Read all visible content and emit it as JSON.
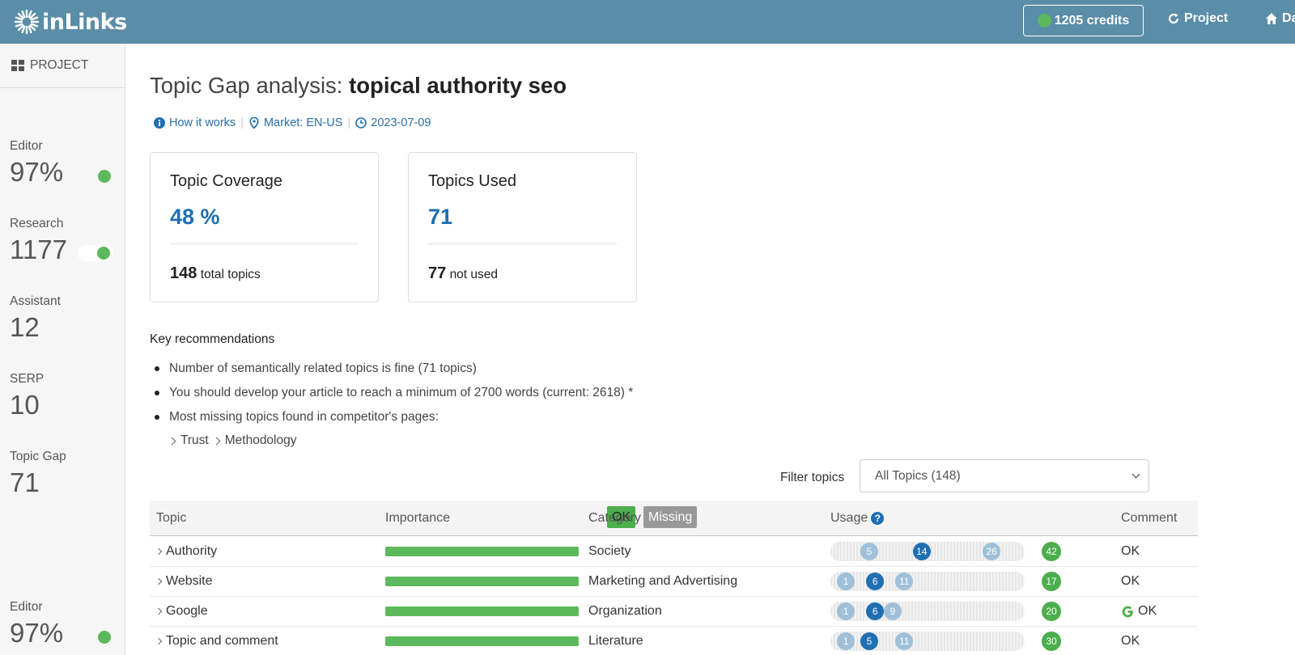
{
  "app": {
    "logo_text": "inLinks",
    "credits_label": "1205 credits",
    "nav_project": "Project",
    "nav_dashboard": "Da"
  },
  "colors": {
    "topbar": "#5a8da8",
    "accent_blue": "#1f6fb2",
    "status_green": "#5cb85c",
    "missing_gray": "#999999"
  },
  "sidebar": {
    "header_label": "PROJECT",
    "stats": [
      {
        "label": "Editor",
        "value": "97%",
        "indicator": "green-dot"
      },
      {
        "label": "Research",
        "value": "1177",
        "indicator": "green-toggle"
      },
      {
        "label": "Assistant",
        "value": "12",
        "indicator": ""
      },
      {
        "label": "SERP",
        "value": "10",
        "indicator": ""
      },
      {
        "label": "Topic Gap",
        "value": "71",
        "indicator": ""
      },
      {
        "label": "Editor",
        "value": "97%",
        "indicator": "green-dot"
      }
    ]
  },
  "page": {
    "title_prefix": "Topic Gap analysis: ",
    "title_keyword": "topical authority seo",
    "how_it_works": "How it works",
    "market": "Market: EN-US",
    "date": "2023-07-09"
  },
  "cards": {
    "coverage": {
      "title": "Topic Coverage",
      "value": "48 %",
      "foot_num": "148",
      "foot_text": "total topics"
    },
    "used": {
      "title": "Topics Used",
      "value": "71",
      "foot_num": "77",
      "foot_text": "not used"
    }
  },
  "recommendations": {
    "title": "Key recommendations",
    "items": [
      "Number of semantically related topics is fine (71 topics)",
      "You should develop your article to reach a minimum of 2700 words (current: 2618) *",
      "Most missing topics found in competitor's pages:"
    ],
    "missing_path": [
      "Trust",
      "Methodology"
    ]
  },
  "filter": {
    "label": "Filter topics",
    "selected": "All Topics (148)"
  },
  "table": {
    "headers": {
      "topic": "Topic",
      "importance": "Importance",
      "ok_badge": "OK",
      "missing_badge": "Missing",
      "category": "Category",
      "usage": "Usage",
      "usage_help": "?",
      "comment": "Comment"
    },
    "rows": [
      {
        "topic": "Authority",
        "importance": 1.0,
        "category": "Society",
        "usage": [
          {
            "value": "5",
            "tone": "light"
          },
          {
            "value": "14",
            "tone": "dark"
          },
          {
            "value": "26",
            "tone": "light"
          }
        ],
        "total": "42",
        "comment": "OK",
        "google": false
      },
      {
        "topic": "Website",
        "importance": 1.0,
        "category": "Marketing and Advertising",
        "usage": [
          {
            "value": "1",
            "tone": "light"
          },
          {
            "value": "6",
            "tone": "dark"
          },
          {
            "value": "11",
            "tone": "light"
          }
        ],
        "total": "17",
        "comment": "OK",
        "google": false
      },
      {
        "topic": "Google",
        "importance": 1.0,
        "category": "Organization",
        "usage": [
          {
            "value": "1",
            "tone": "light"
          },
          {
            "value": "6",
            "tone": "dark"
          },
          {
            "value": "9",
            "tone": "light"
          }
        ],
        "total": "20",
        "comment": "OK",
        "google": true
      },
      {
        "topic": "Topic and comment",
        "importance": 1.0,
        "category": "Literature",
        "usage": [
          {
            "value": "1",
            "tone": "light"
          },
          {
            "value": "5",
            "tone": "dark"
          },
          {
            "value": "11",
            "tone": "light"
          }
        ],
        "total": "30",
        "comment": "OK",
        "google": false
      }
    ]
  }
}
